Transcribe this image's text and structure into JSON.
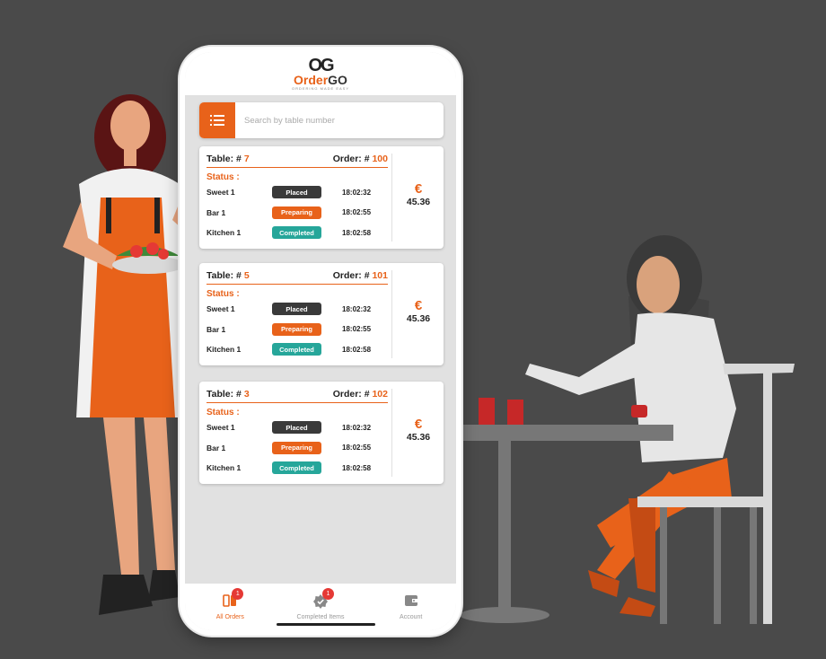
{
  "brand": {
    "mark": "OG",
    "name_part1": "Order",
    "name_part2": "GO",
    "tagline": "ORDERING MADE EASY"
  },
  "search": {
    "placeholder": "Search by table number",
    "icon": "list-icon"
  },
  "status_label": "Status :",
  "table_prefix": "Table: #",
  "order_prefix": "Order: #",
  "currency": "€",
  "orders": [
    {
      "table": "7",
      "order": "100",
      "amount": "45.36",
      "items": [
        {
          "name": "Sweet 1",
          "status": "Placed",
          "time": "18:02:32"
        },
        {
          "name": "Bar 1",
          "status": "Preparing",
          "time": "18:02:55"
        },
        {
          "name": "Kitchen 1",
          "status": "Completed",
          "time": "18:02:58"
        }
      ]
    },
    {
      "table": "5",
      "order": "101",
      "amount": "45.36",
      "items": [
        {
          "name": "Sweet 1",
          "status": "Placed",
          "time": "18:02:32"
        },
        {
          "name": "Bar 1",
          "status": "Preparing",
          "time": "18:02:55"
        },
        {
          "name": "Kitchen 1",
          "status": "Completed",
          "time": "18:02:58"
        }
      ]
    },
    {
      "table": "3",
      "order": "102",
      "amount": "45.36",
      "items": [
        {
          "name": "Sweet 1",
          "status": "Placed",
          "time": "18:02:32"
        },
        {
          "name": "Bar 1",
          "status": "Preparing",
          "time": "18:02:55"
        },
        {
          "name": "Kitchen 1",
          "status": "Completed",
          "time": "18:02:58"
        }
      ]
    }
  ],
  "nav": {
    "all_orders": {
      "label": "All Orders",
      "badge": "1",
      "icon": "orders-icon"
    },
    "completed_items": {
      "label": "Completed Items",
      "badge": "1",
      "icon": "check-badge-icon"
    },
    "account": {
      "label": "Account",
      "icon": "wallet-icon"
    }
  },
  "colors": {
    "background": "#4a4a4a",
    "accent": "#e8621a",
    "placed": "#3a3a3a",
    "completed": "#26a69a",
    "badge": "#e53935"
  }
}
